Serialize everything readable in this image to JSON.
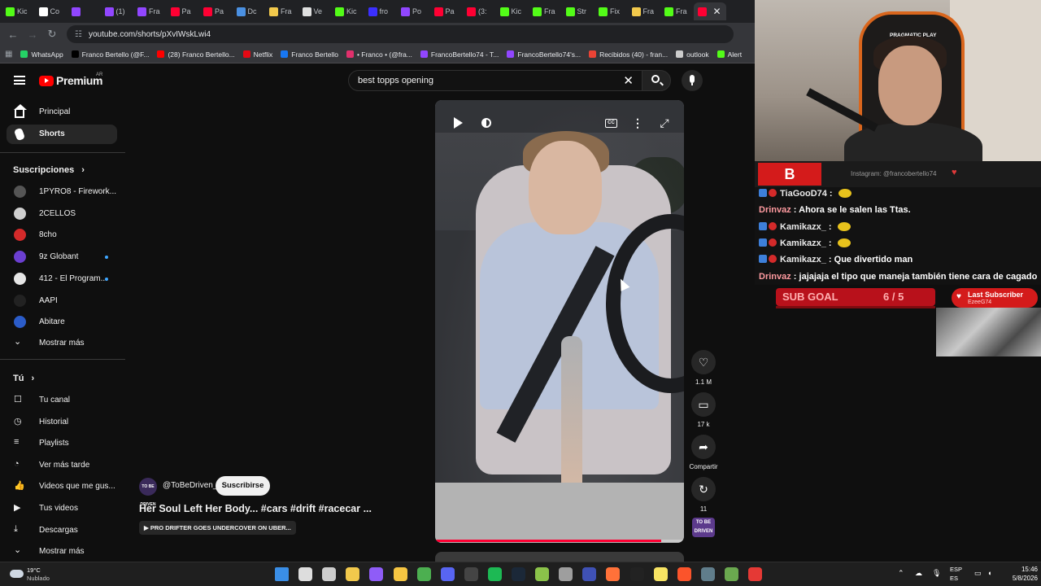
{
  "browser": {
    "tabs": [
      {
        "label": "Kic",
        "color": "#53fc18"
      },
      {
        "label": "Co",
        "color": "#ffffff"
      },
      {
        "label": "",
        "color": "#9146ff"
      },
      {
        "label": "(1)",
        "color": "#9146ff"
      },
      {
        "label": "Fra",
        "color": "#9146ff"
      },
      {
        "label": "Pa",
        "color": "#ff0033"
      },
      {
        "label": "Pa",
        "color": "#ff0033"
      },
      {
        "label": "Dc",
        "color": "#4a90e2"
      },
      {
        "label": "Fra",
        "color": "#f2c94c"
      },
      {
        "label": "Ve",
        "color": "#e0e0e0"
      },
      {
        "label": "Kic",
        "color": "#53fc18"
      },
      {
        "label": "fro",
        "color": "#3b2fff"
      },
      {
        "label": "Po",
        "color": "#9146ff"
      },
      {
        "label": "Pa",
        "color": "#ff0033"
      },
      {
        "label": "(3:",
        "color": "#ff0033"
      },
      {
        "label": "Kic",
        "color": "#53fc18"
      },
      {
        "label": "Fra",
        "color": "#53fc18"
      },
      {
        "label": "Str",
        "color": "#53fc18"
      },
      {
        "label": "Fix",
        "color": "#53fc18"
      },
      {
        "label": "Fra",
        "color": "#f2c94c"
      },
      {
        "label": "Fra",
        "color": "#53fc18"
      },
      {
        "label": "",
        "color": "#ff0033"
      }
    ],
    "url": "youtube.com/shorts/pXvIWskLwi4",
    "bookmarks": [
      {
        "label": "WhatsApp",
        "color": "#25d366"
      },
      {
        "label": "Franco Bertello (@F...",
        "color": "#000000"
      },
      {
        "label": "(28) Franco Bertello...",
        "color": "#ff0000"
      },
      {
        "label": "Netflix",
        "color": "#e50914"
      },
      {
        "label": "Franco Bertello",
        "color": "#1877f2"
      },
      {
        "label": "• Franco • (@fra...",
        "color": "#e1306c"
      },
      {
        "label": "FrancoBertello74 - T...",
        "color": "#9146ff"
      },
      {
        "label": "FrancoBertello74's...",
        "color": "#9146ff"
      },
      {
        "label": "Recibidos (40) - fran...",
        "color": "#ea4335"
      },
      {
        "label": "outlook",
        "color": "#cccccc"
      },
      {
        "label": "Alert",
        "color": "#53fc18"
      }
    ]
  },
  "youtube": {
    "logo_text": "Premium",
    "region": "AR",
    "search_value": "best topps opening",
    "sidebar": {
      "main": [
        {
          "label": "Principal"
        },
        {
          "label": "Shorts"
        }
      ],
      "subscriptions_header": "Suscripciones",
      "subscriptions": [
        {
          "label": "1PYRO8 - Firework...",
          "color": "#555555",
          "new": false
        },
        {
          "label": "2CELLOS",
          "color": "#cfcfcf",
          "new": false
        },
        {
          "label": "8cho",
          "color": "#d42a2a",
          "new": false
        },
        {
          "label": "9z Globant",
          "color": "#6b3fd1",
          "new": true
        },
        {
          "label": "412 - El Program...",
          "color": "#e6e6e6",
          "new": true
        },
        {
          "label": "AAPI",
          "color": "#222222",
          "new": false
        },
        {
          "label": "Abitare",
          "color": "#2b5cc9",
          "new": false
        }
      ],
      "show_more_1": "Mostrar más",
      "you_header": "Tú",
      "you_items": [
        {
          "label": "Tu canal"
        },
        {
          "label": "Historial"
        },
        {
          "label": "Playlists"
        },
        {
          "label": "Ver más tarde"
        },
        {
          "label": "Videos que me gus..."
        },
        {
          "label": "Tus videos"
        },
        {
          "label": "Descargas"
        }
      ],
      "show_more_2": "Mostrar más"
    },
    "short": {
      "channel": "@ToBeDriven_",
      "channel_avatar_text": "TO BE DRIVEN",
      "subscribe": "Suscribirse",
      "title": "Her Soul Left Her Body... #cars #drift #racecar ...",
      "music": "▶ PRO DRIFTER GOES UNDERCOVER ON UBER...",
      "progress": 0.91,
      "likes": "1.1 M",
      "comments": "17 k",
      "share": "Compartir",
      "remix": "11"
    }
  },
  "stream": {
    "cam_brand": "PRAGMATIC PLAY",
    "chat_logo": "B",
    "instagram": "Instagram: @francobertello74",
    "messages": [
      {
        "user": "TiaGooD74",
        "text": "",
        "emote": true,
        "badges": true
      },
      {
        "user": "Drinvaz",
        "text": "Ahora se le salen las Ttas.",
        "emote": false,
        "badges": false
      },
      {
        "user": "Kamikazx_",
        "text": "",
        "emote": true,
        "badges": true
      },
      {
        "user": "Kamikazx_",
        "text": "",
        "emote": true,
        "badges": true
      },
      {
        "user": "Kamikazx_",
        "text": "Que divertido man",
        "emote": false,
        "badges": true
      },
      {
        "user": "Drinvaz",
        "text": "jajajaja el tipo que maneja también tiene cara de cagado",
        "emote": false,
        "badges": false
      }
    ],
    "sub_goal_label": "SUB GOAL",
    "sub_goal_value": "6 / 5",
    "last_subscriber_label": "Last Subscriber",
    "last_subscriber_name": "EzeeG74"
  },
  "taskbar": {
    "temp": "19°C",
    "condition": "Nublado",
    "lang_1": "ESP",
    "lang_2": "ES",
    "time": "15:46",
    "date": "5/8/2026",
    "apps": [
      {
        "name": "windows-start-icon",
        "color": "#3a8ee6"
      },
      {
        "name": "search-icon",
        "color": "#dddddd"
      },
      {
        "name": "task-view-icon",
        "color": "#cccccc"
      },
      {
        "name": "store-icon",
        "color": "#f2c94c"
      },
      {
        "name": "app-purple-icon",
        "color": "#8f5cf7"
      },
      {
        "name": "file-explorer-icon",
        "color": "#f5c542"
      },
      {
        "name": "chrome-icon",
        "color": "#4caf50"
      },
      {
        "name": "discord-icon",
        "color": "#5865f2"
      },
      {
        "name": "obs-icon",
        "color": "#444444"
      },
      {
        "name": "spotify-icon",
        "color": "#1db954"
      },
      {
        "name": "steam-icon",
        "color": "#1b2838"
      },
      {
        "name": "app-green-icon",
        "color": "#8bc34a"
      },
      {
        "name": "app-gray-icon",
        "color": "#9e9e9e"
      },
      {
        "name": "app-blue-icon",
        "color": "#3f51b5"
      },
      {
        "name": "firefox-icon",
        "color": "#ff7139"
      },
      {
        "name": "terminal-icon",
        "color": "#222222"
      },
      {
        "name": "notes-icon",
        "color": "#f7e463"
      },
      {
        "name": "brave-icon",
        "color": "#fb542b"
      },
      {
        "name": "calculator-icon",
        "color": "#607d8b"
      },
      {
        "name": "minecraft-icon",
        "color": "#6aa84f"
      },
      {
        "name": "chrome-2-icon",
        "color": "#e53935"
      }
    ]
  }
}
